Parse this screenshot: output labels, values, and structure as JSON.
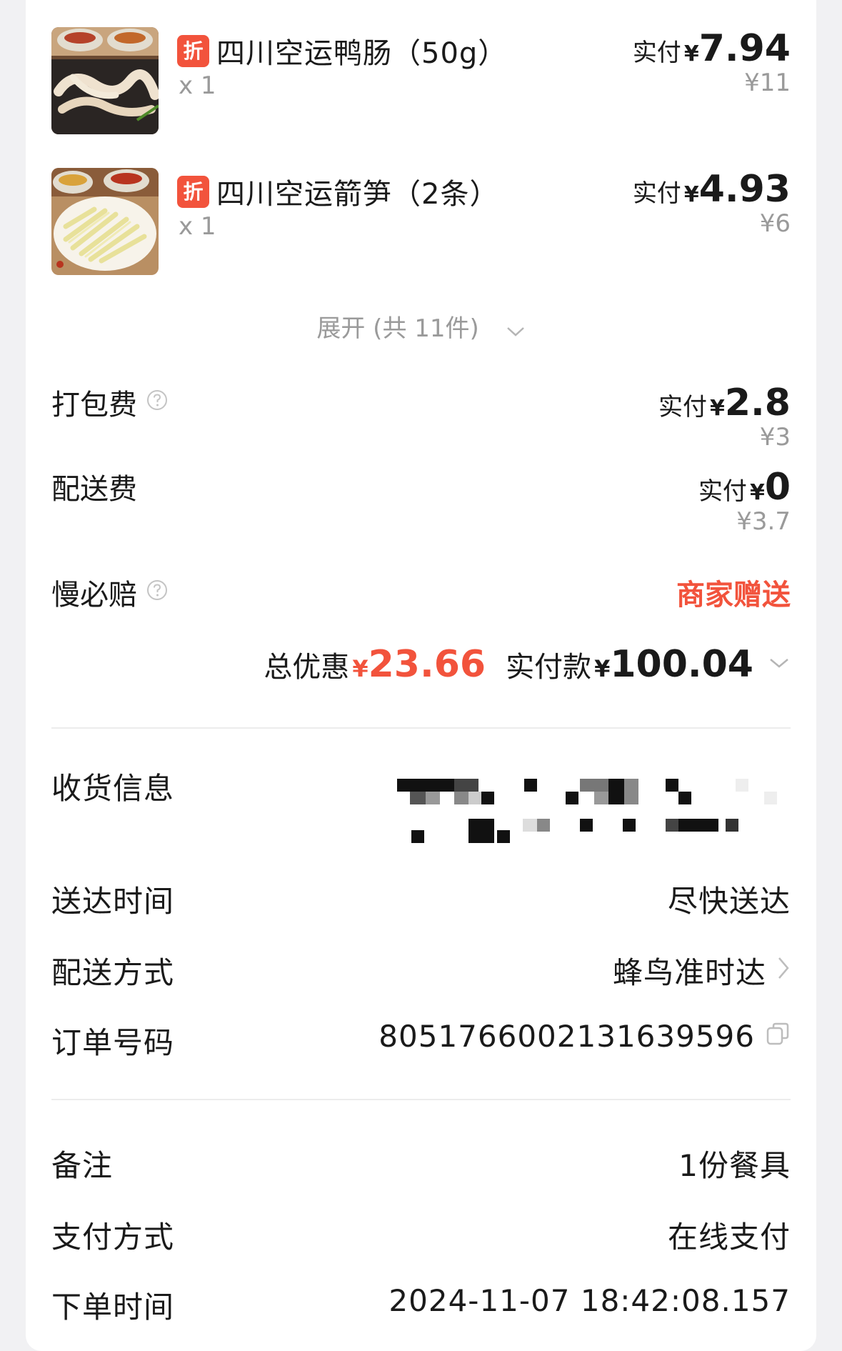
{
  "items": [
    {
      "tag": "折",
      "name": "四川空运鸭肠（50g）",
      "qty": "x 1",
      "pay_label": "实付",
      "yen": "¥",
      "pay_value": "7.94",
      "orig": "¥11"
    },
    {
      "tag": "折",
      "name": "四川空运箭笋（2条）",
      "qty": "x 1",
      "pay_label": "实付",
      "yen": "¥",
      "pay_value": "4.93",
      "orig": "¥6"
    }
  ],
  "expand": {
    "label": "展开 (共 11件)"
  },
  "fees": {
    "packing": {
      "label": "打包费",
      "pay_label": "实付",
      "yen": "¥",
      "pay_value": "2.8",
      "orig": "¥3"
    },
    "delivery": {
      "label": "配送费",
      "pay_label": "实付",
      "yen": "¥",
      "pay_value": "0",
      "orig": "¥3.7"
    },
    "slow_compensation": {
      "label": "慢必赔",
      "value": "商家赠送"
    }
  },
  "summary": {
    "discount_label": "总优惠",
    "discount_yen": "¥",
    "discount_value": "23.66",
    "total_label": "实付款",
    "total_yen": "¥",
    "total_value": "100.04"
  },
  "info": {
    "address_label": "收货信息",
    "delivery_time_label": "送达时间",
    "delivery_time_value": "尽快送达",
    "delivery_method_label": "配送方式",
    "delivery_method_value": "蜂鸟准时达",
    "order_no_label": "订单号码",
    "order_no_value": "8051766002131639596",
    "remark_label": "备注",
    "remark_value": "1份餐具",
    "payment_label": "支付方式",
    "payment_value": "在线支付",
    "order_time_label": "下单时间",
    "order_time_value": "2024-11-07 18:42:08.157"
  },
  "colors": {
    "accent_red": "#f2533c",
    "muted_gray": "#9a9a9a",
    "text": "#1a1a1a"
  },
  "icons": [
    "discount-tag",
    "question-circle-icon",
    "chevron-down-icon",
    "chevron-right-icon",
    "copy-icon"
  ]
}
